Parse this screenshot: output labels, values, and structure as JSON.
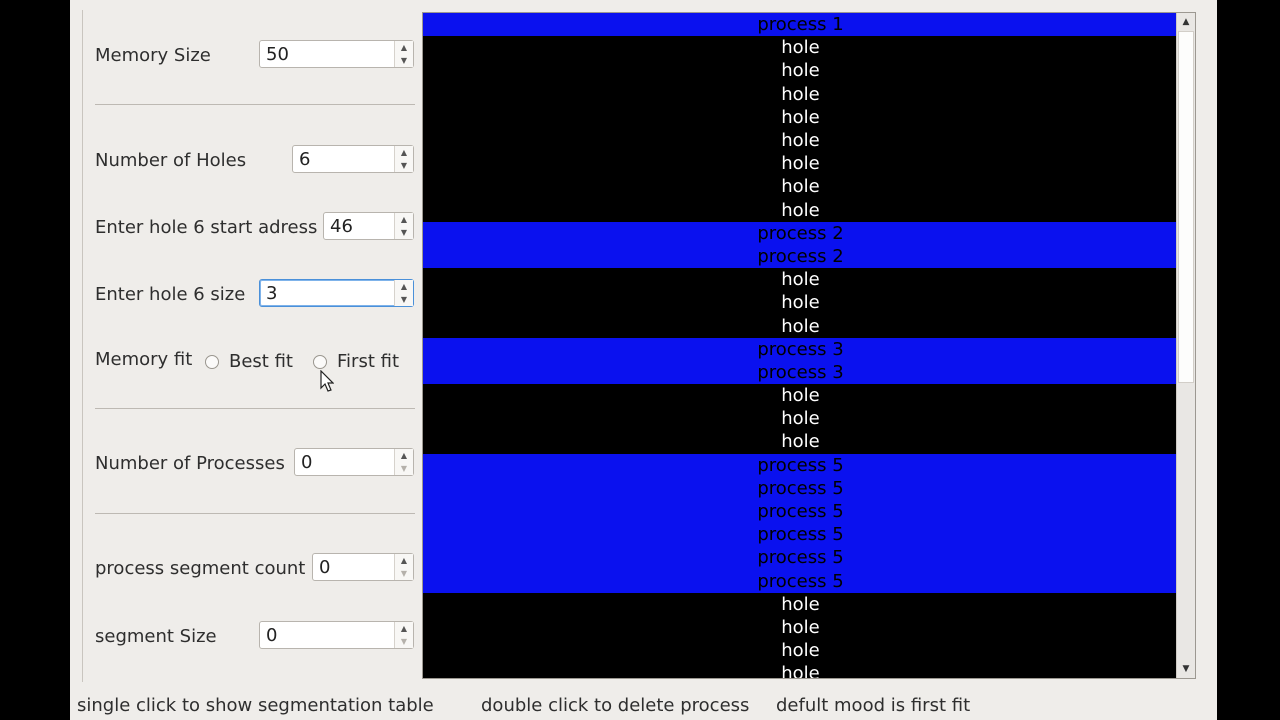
{
  "form": {
    "memory_size": {
      "label": "Memory Size",
      "value": "50"
    },
    "holes_count": {
      "label": "Number of Holes",
      "value": "6"
    },
    "hole_start": {
      "label": "Enter hole 6 start adress",
      "value": "46"
    },
    "hole_size": {
      "label": "Enter hole 6 size",
      "value": "3"
    },
    "memory_fit": {
      "label": "Memory fit",
      "options": [
        "Best fit",
        "First fit"
      ],
      "selected": null
    },
    "processes_count": {
      "label": "Number of Processes",
      "value": "0"
    },
    "segment_count": {
      "label": "process segment count",
      "value": "0"
    },
    "segment_size": {
      "label": "segment Size",
      "value": "0"
    }
  },
  "memory_view": {
    "colors": {
      "process": "#0a11ef",
      "hole": "#000000",
      "hole_text": "#ffffff"
    },
    "rows": [
      {
        "type": "process",
        "label": "process 1"
      },
      {
        "type": "hole",
        "label": "hole"
      },
      {
        "type": "hole",
        "label": "hole"
      },
      {
        "type": "hole",
        "label": "hole"
      },
      {
        "type": "hole",
        "label": "hole"
      },
      {
        "type": "hole",
        "label": "hole"
      },
      {
        "type": "hole",
        "label": "hole"
      },
      {
        "type": "hole",
        "label": "hole"
      },
      {
        "type": "hole",
        "label": "hole"
      },
      {
        "type": "process",
        "label": "process 2"
      },
      {
        "type": "process",
        "label": "process 2"
      },
      {
        "type": "hole",
        "label": "hole"
      },
      {
        "type": "hole",
        "label": "hole"
      },
      {
        "type": "hole",
        "label": "hole"
      },
      {
        "type": "process",
        "label": "process 3"
      },
      {
        "type": "process",
        "label": "process 3"
      },
      {
        "type": "hole",
        "label": "hole"
      },
      {
        "type": "hole",
        "label": "hole"
      },
      {
        "type": "hole",
        "label": "hole"
      },
      {
        "type": "process",
        "label": "process 5"
      },
      {
        "type": "process",
        "label": "process 5"
      },
      {
        "type": "process",
        "label": "process 5"
      },
      {
        "type": "process",
        "label": "process 5"
      },
      {
        "type": "process",
        "label": "process 5"
      },
      {
        "type": "process",
        "label": "process 5"
      },
      {
        "type": "hole",
        "label": "hole"
      },
      {
        "type": "hole",
        "label": "hole"
      },
      {
        "type": "hole",
        "label": "hole"
      },
      {
        "type": "hole",
        "label": "hole"
      }
    ]
  },
  "status_bar": {
    "hint_single_click": "single click to show segmentation table",
    "hint_double_click": "double click to delete process",
    "hint_default_mode": "defult mood is first fit"
  },
  "icons": {
    "spin_up": "up-arrow-icon",
    "spin_down": "down-arrow-icon",
    "scroll_up": "scroll-up-icon",
    "scroll_down": "scroll-down-icon",
    "cursor": "mouse-pointer-icon"
  }
}
